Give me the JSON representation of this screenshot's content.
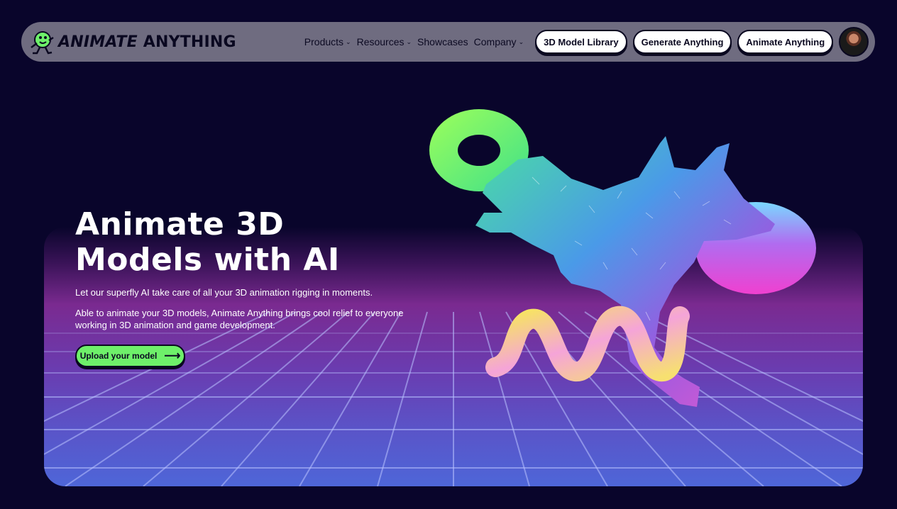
{
  "brand": {
    "name_italic": "ANIMATE",
    "name_rest": " ANYTHING",
    "accent": "#6ef06a",
    "background": "#09052b"
  },
  "nav": {
    "menu": [
      {
        "label": "Products",
        "has_dropdown": true
      },
      {
        "label": "Resources",
        "has_dropdown": true
      },
      {
        "label": "Showcases",
        "has_dropdown": false
      },
      {
        "label": "Company",
        "has_dropdown": true
      }
    ],
    "buttons": [
      {
        "label": "3D Model Library"
      },
      {
        "label": "Generate Anything"
      },
      {
        "label": "Animate Anything"
      }
    ],
    "chevron": "⌄"
  },
  "hero": {
    "headline_line1": "Animate 3D",
    "headline_line2": "Models with AI",
    "sub1": "Let our superfly AI take care of all your 3D animation rigging in moments.",
    "sub2": "Able to animate your 3D models, Animate Anything brings cool relief to everyone working in 3D animation and game development.",
    "cta_label": "Upload your model",
    "cta_icon": "arrow-right-icon"
  }
}
